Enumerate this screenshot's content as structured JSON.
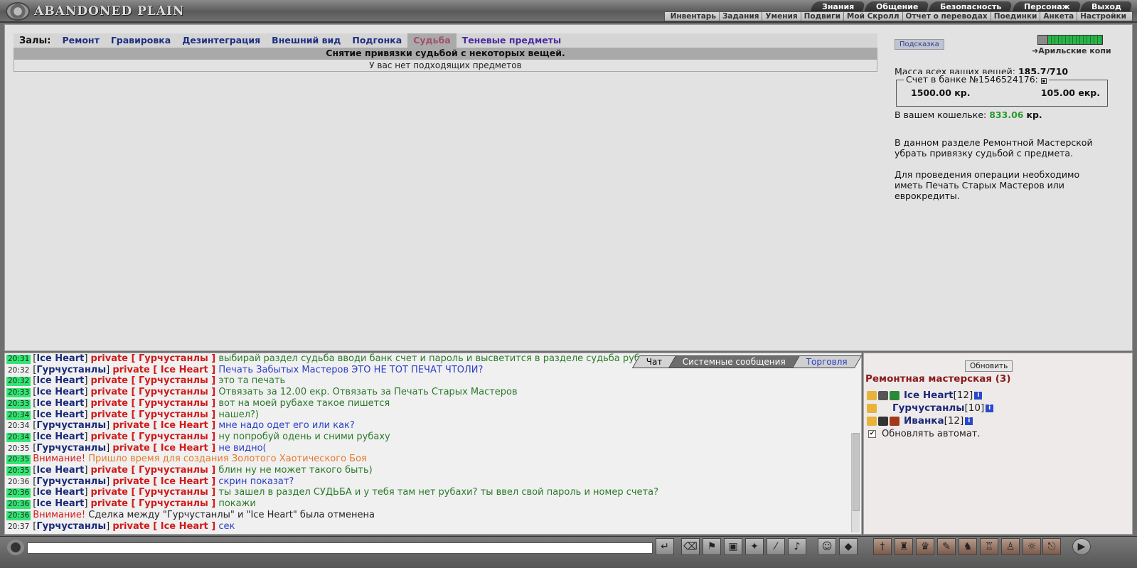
{
  "app": {
    "title": "ABANDONED PLAIN"
  },
  "topmenu": {
    "primary": [
      "Знания",
      "Общение",
      "Безопасность",
      "Персонаж",
      "Выход"
    ],
    "secondary": [
      "Инвентарь",
      "Задания",
      "Умения",
      "Подвиги",
      "Мой Скролл",
      "Отчет о переводах",
      "Поединки",
      "Анкета",
      "Настройки"
    ]
  },
  "halls": {
    "label": "Залы:",
    "tabs": [
      "Ремонт",
      "Гравировка",
      "Дезинтеграция",
      "Внешний вид",
      "Подгонка",
      "Судьба",
      "Теневые предметы"
    ],
    "active": "Судьба"
  },
  "content": {
    "header": "Снятие привязки судьбой с некоторых вещей.",
    "empty": "У вас нет подходящих предметов"
  },
  "side": {
    "hint": "Подсказка",
    "location": "Арильские копи",
    "mass_label": "Масса всех ваших вещей:",
    "mass_value": "185.7/710",
    "bank_label": "Счет в банке №1546524176:",
    "bank_kr": "1500.00 кр.",
    "bank_ekr": "105.00 екр.",
    "wallet_label": "В вашем кошельке:",
    "wallet_value": "833.06",
    "wallet_unit": "кр.",
    "desc1": "В данном разделе Ремонтной Мастерской убрать привязку судьбой с предмета.",
    "desc2": "Для проведения операции необходимо иметь Печать Старых Мастеров или еврокредиты."
  },
  "chat": {
    "tabs": [
      "Чат",
      "Системные сообщения",
      "Торговля"
    ],
    "messages": [
      {
        "time": "20:31",
        "hl": true,
        "from": "Ice Heart",
        "to": "Гурчустанлы",
        "text": "выбирай раздел судьба вводи банк счет и пароль и высветится в разделе судьба рубаха",
        "color": "green"
      },
      {
        "time": "20:32",
        "hl": false,
        "from": "Гурчустанлы",
        "to": "Ice Heart",
        "text": "Печать Забытых Мастеров ЭТО НЕ ТОТ ПЕЧАТ ЧТОЛИ?",
        "color": "blue"
      },
      {
        "time": "20:32",
        "hl": true,
        "from": "Ice Heart",
        "to": "Гурчустанлы",
        "text": "это та печать",
        "color": "green"
      },
      {
        "time": "20:33",
        "hl": true,
        "from": "Ice Heart",
        "to": "Гурчустанлы",
        "text": "Отвязать за 12.00 екр. Отвязать за Печать Старых Мастеров",
        "color": "green"
      },
      {
        "time": "20:33",
        "hl": true,
        "from": "Ice Heart",
        "to": "Гурчустанлы",
        "text": "вот на моей рубахе такое пишется",
        "color": "green"
      },
      {
        "time": "20:34",
        "hl": true,
        "from": "Ice Heart",
        "to": "Гурчустанлы",
        "text": "нашел?)",
        "color": "green"
      },
      {
        "time": "20:34",
        "hl": false,
        "from": "Гурчустанлы",
        "to": "Ice Heart",
        "text": "мне надо одет его или как?",
        "color": "blue"
      },
      {
        "time": "20:34",
        "hl": true,
        "from": "Ice Heart",
        "to": "Гурчустанлы",
        "text": "ну попробуй одень и сними рубаху",
        "color": "green"
      },
      {
        "time": "20:35",
        "hl": false,
        "from": "Гурчустанлы",
        "to": "Ice Heart",
        "text": "не видно(",
        "color": "blue"
      },
      {
        "time": "20:35",
        "hl": true,
        "system": true,
        "warn": "Внимание!",
        "text": "Пришло время для создания Золотого Хаотического Боя",
        "color": "orange"
      },
      {
        "time": "20:35",
        "hl": true,
        "from": "Ice Heart",
        "to": "Гурчустанлы",
        "text": "блин ну не может такого быть)",
        "color": "green"
      },
      {
        "time": "20:36",
        "hl": false,
        "from": "Гурчустанлы",
        "to": "Ice Heart",
        "text": "скрин показат?",
        "color": "blue"
      },
      {
        "time": "20:36",
        "hl": true,
        "from": "Ice Heart",
        "to": "Гурчустанлы",
        "text": "ты зашел в раздел СУДЬБА и у тебя там нет рубахи? ты ввел свой пароль и номер счета?",
        "color": "green"
      },
      {
        "time": "20:36",
        "hl": true,
        "from": "Ice Heart",
        "to": "Гурчустанлы",
        "text": "покажи",
        "color": "green"
      },
      {
        "time": "20:36",
        "hl": true,
        "system": true,
        "warn": "Внимание!",
        "text": "Сделка между \"Гурчустанлы\" и \"Ice Heart\" была отменена",
        "color": "black"
      },
      {
        "time": "20:37",
        "hl": false,
        "from": "Гурчустанлы",
        "to": "Ice Heart",
        "text": "сек",
        "color": "blue"
      }
    ],
    "private_word": "private"
  },
  "room": {
    "refresh": "Обновить",
    "title": "Ремонтная мастерская (3)",
    "users": [
      {
        "nick": "Ice Heart",
        "level": "[12]"
      },
      {
        "nick": "Гурчустанлы",
        "level": "[10]"
      },
      {
        "nick": "Иванка",
        "level": "[12]"
      }
    ],
    "auto_label": "Обновлять автомат."
  },
  "colors": {
    "accent": "#1a2a7a",
    "private": "#d11a1a",
    "highlight": "#33e673",
    "wallet": "#2e9a2e"
  }
}
